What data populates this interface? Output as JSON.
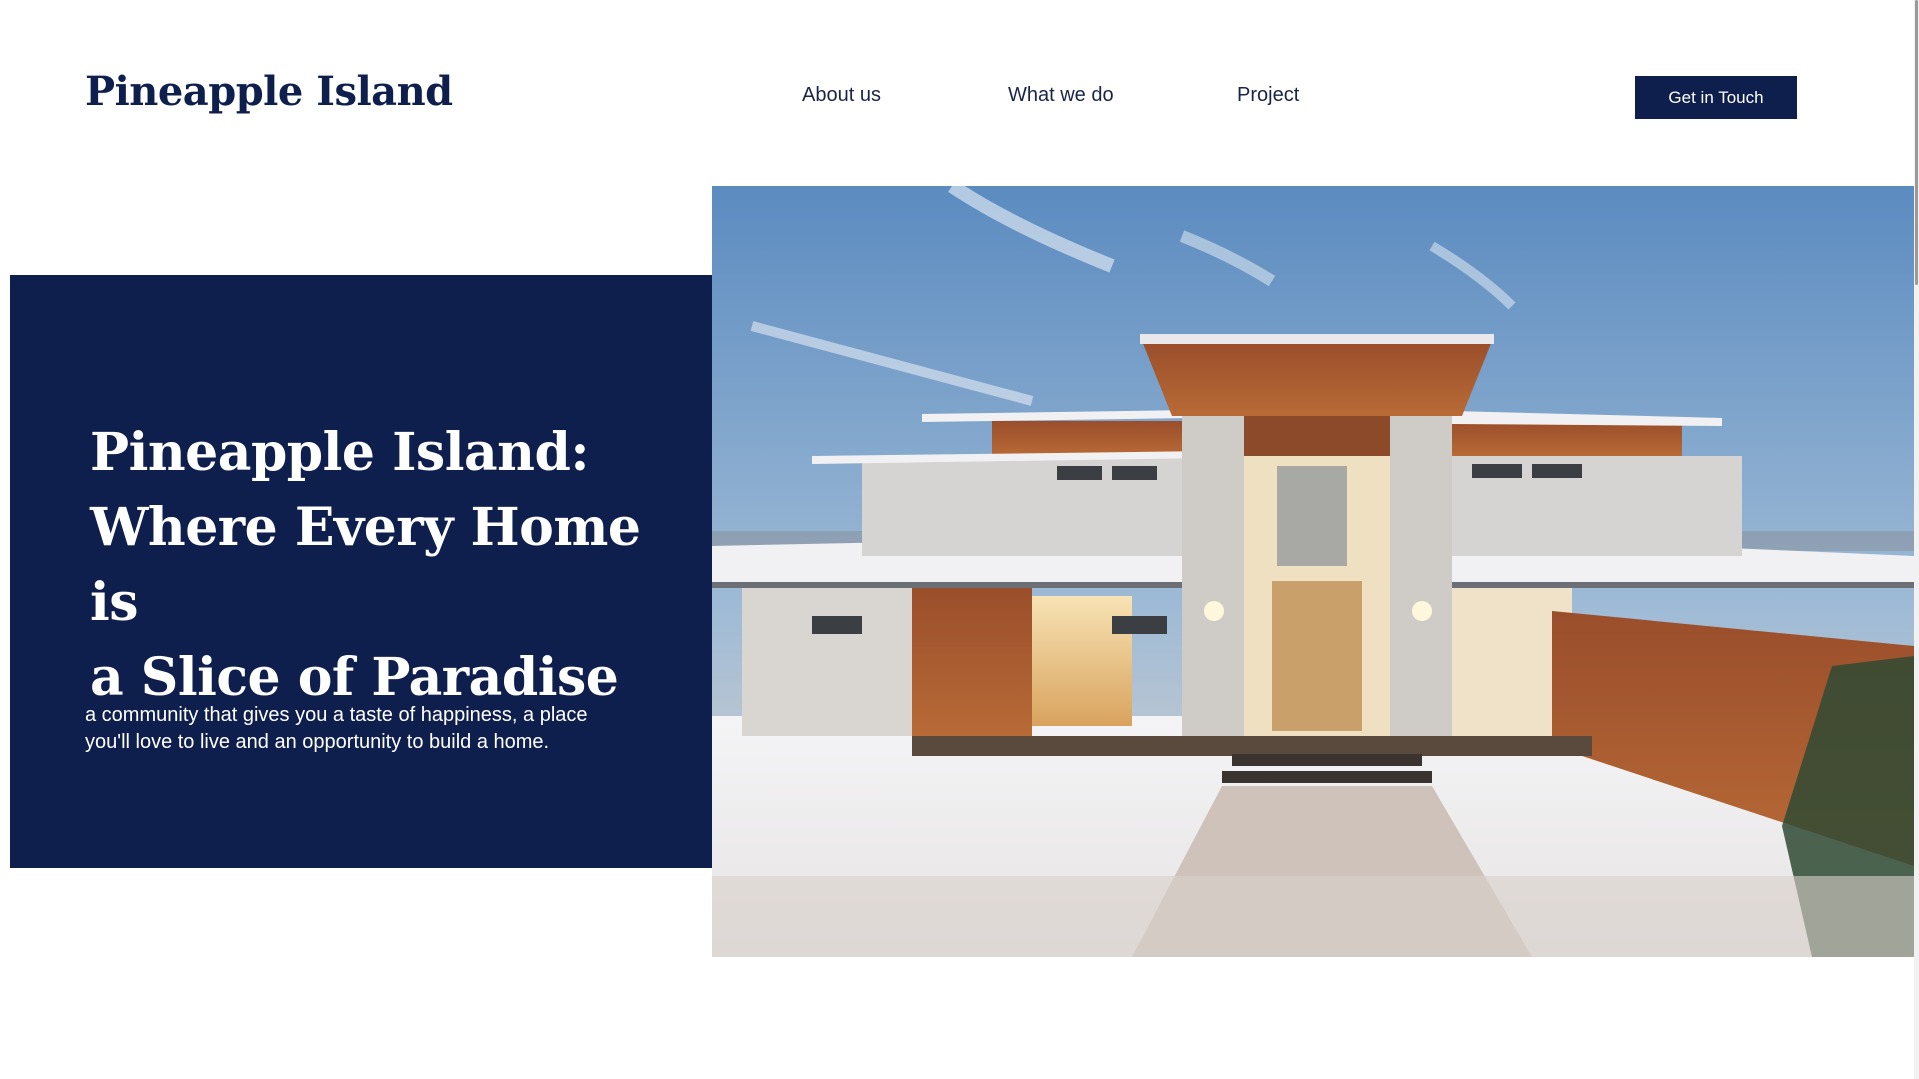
{
  "header": {
    "logo": "Pineapple Island",
    "nav": [
      {
        "label": "About us"
      },
      {
        "label": "What we do"
      },
      {
        "label": "Project"
      }
    ],
    "cta_label": "Get in Touch"
  },
  "hero": {
    "title_lines": [
      "Pineapple Island:",
      "Where Every Home is",
      "a Slice of Paradise"
    ],
    "subtitle_lines": [
      "a community that gives you a taste of happiness, a place",
      "you'll love to live and an opportunity to build a home."
    ]
  },
  "colors": {
    "brand_navy": "#0f1f4d",
    "white": "#ffffff"
  },
  "icons": {
    "hero_image": "modern-house-in-snow-photo"
  }
}
